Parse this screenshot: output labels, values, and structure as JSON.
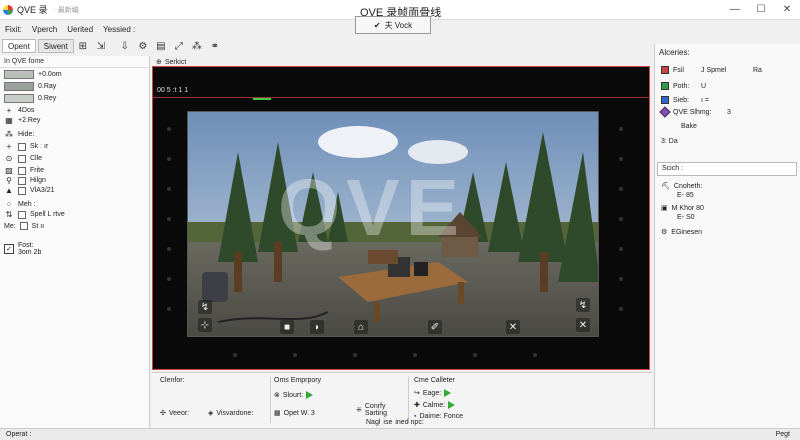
{
  "app": {
    "name": "QVE 录",
    "subtitle": "· 最新编",
    "window_title": "QVE 录帧面骨线"
  },
  "window_controls": {
    "minimize": "—",
    "maximize": "☐",
    "close": "✕"
  },
  "menu": [
    "Fixit:",
    "Vperch",
    "Uerited",
    "Yessied :"
  ],
  "mode_select": {
    "value": "夫 Vock"
  },
  "toolbar": {
    "tabs": [
      "Opent",
      "Siwent"
    ]
  },
  "left_panel": {
    "header": "In QVE fome",
    "swatches": [
      {
        "label": "+0.0om",
        "color": "#b8c0b8"
      },
      {
        "label": "0.Ray",
        "color": "#9aa09a"
      },
      {
        "label": "0.Rey",
        "color": "#c8ccc8"
      }
    ],
    "rows": [
      {
        "icon": "+",
        "label": "4Dos"
      },
      {
        "icon": "▦",
        "label": "+2.Rey"
      },
      {
        "icon": "⁂",
        "label": "Hide:"
      },
      {
        "icon": "+",
        "label": "Sk  ː ır"
      },
      {
        "icon": "⊙",
        "label": "Clle"
      },
      {
        "icon": "▨",
        "label": "Frite"
      },
      {
        "icon": "⚲",
        "label": "Hilgn"
      },
      {
        "icon": "▲",
        "label": "VlA3/21"
      }
    ],
    "section2": "Meh :",
    "rows2": [
      {
        "icon": "⇅",
        "label": "Spell L rtve"
      },
      {
        "icon": "Me:",
        "label": "St  ıı"
      }
    ],
    "section3": {
      "label": "Fost:",
      "value": "3om 2b"
    }
  },
  "viewport": {
    "tab_label": "Serkict",
    "counter": "00 5 :t 1 1"
  },
  "game": {
    "watermark": "QVE",
    "buttons": {
      "top_left": "↯",
      "mid_left": "⊹",
      "top_right": "↯",
      "bottom_right": "✕"
    },
    "action_bar": [
      "■",
      "◗",
      "⌂",
      "✐",
      "✕"
    ]
  },
  "right_panel": {
    "title": "Alceries:",
    "list": [
      {
        "label": "Fsil",
        "col2": "J Spmel",
        "col3": "Ra",
        "color": "#cc4444"
      },
      {
        "label": "Poth:",
        "col2": "U",
        "color": "#2e9c4a"
      },
      {
        "label": "Sieb:",
        "col2": "ı =",
        "color": "#3366cc"
      },
      {
        "label": "QVE Slhmg:",
        "col2": "3",
        "color": "#8b4cbf"
      },
      {
        "label": "",
        "col2": "Bake",
        "color": "#666666"
      },
      {
        "label": "3: Da",
        "col2": "",
        "color": "#888888"
      }
    ],
    "tab": "Scich :",
    "props": [
      {
        "icon": "⛏",
        "label": "Cnoheth:",
        "value": "E-  85"
      },
      {
        "icon": "▣",
        "label": "M Khor 80",
        "value": "E-  S0"
      },
      {
        "icon": "⚙",
        "label": "EGinesen",
        "value": ""
      }
    ]
  },
  "bottom_panel": {
    "groups": [
      {
        "title": "Clenfor:",
        "items": [
          {
            "icon": "✣",
            "label": "Veeor:"
          },
          {
            "icon": "◈",
            "label": "Visvardone:"
          }
        ]
      },
      {
        "title": "Oms Emprpory",
        "items": [
          {
            "icon": "⊗",
            "label": "Slourt:"
          },
          {
            "icon": "▦",
            "label": "Opet  W. 3"
          },
          {
            "icon": "⁜",
            "label": "Conrfy Sarting"
          }
        ]
      },
      {
        "title": "Cme Calleter",
        "items": [
          {
            "icon": "↪",
            "label": "Eage:"
          },
          {
            "icon": "✚",
            "label": "Calme:"
          },
          {
            "icon": "▪",
            "label": "Daime: Fonce"
          }
        ]
      }
    ],
    "footer": [
      "Nagl",
      "ise",
      "ined npc:"
    ]
  },
  "statusbar": {
    "left": "Operat :",
    "right": "Pegt"
  }
}
